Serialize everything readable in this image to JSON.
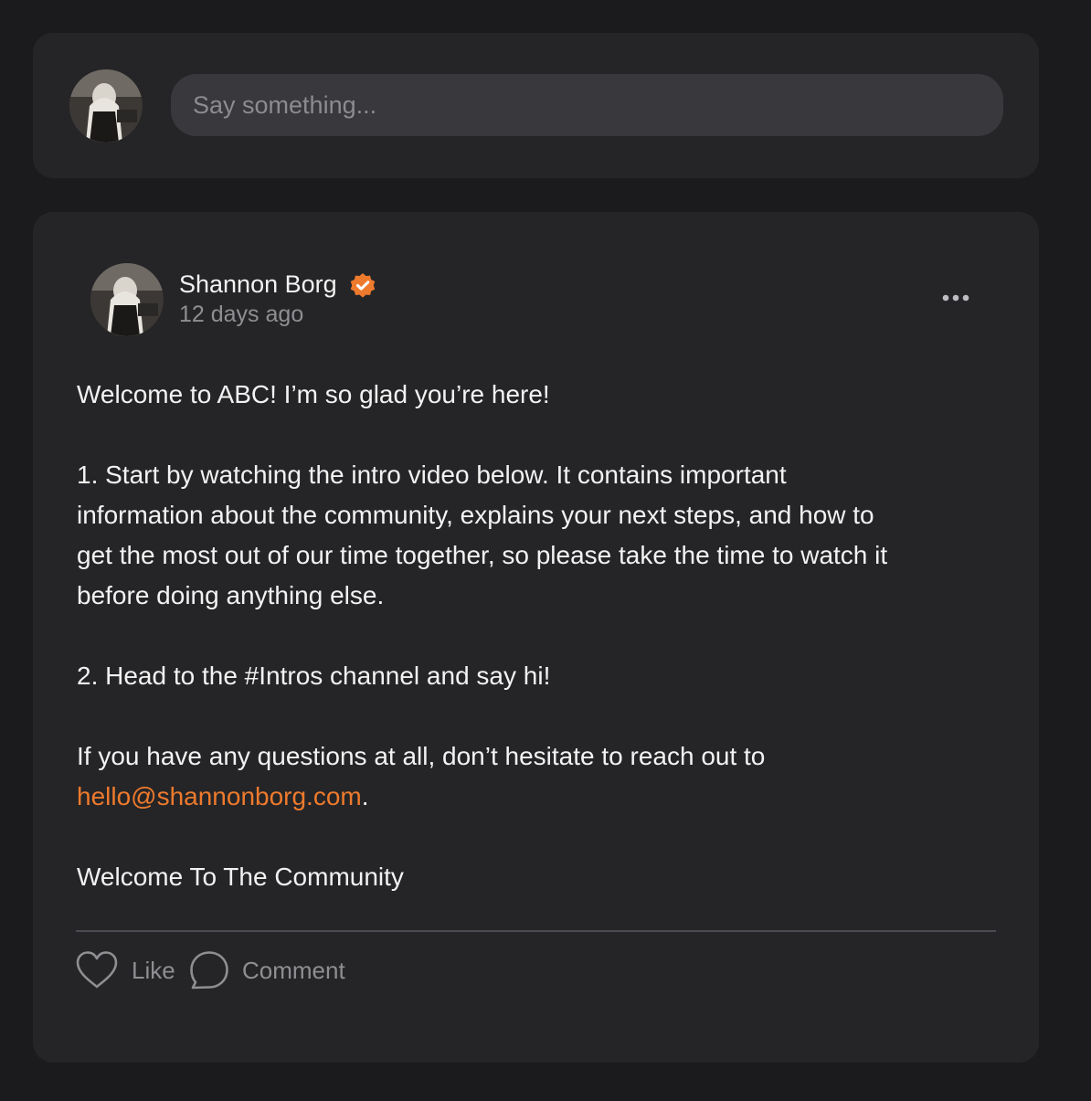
{
  "composer": {
    "placeholder": "Say something..."
  },
  "post": {
    "author": "Shannon Borg",
    "time_ago": "12 days ago",
    "body": {
      "greeting": "Welcome to ABC! I’m so glad you’re here!",
      "step1_line1": "1. Start by watching the intro video below. It contains important",
      "step1_line2": "information about the community, explains your next steps, and how to",
      "step1_line3": "get the most out of our time together, so please take the time to watch it",
      "step1_line4": "before doing anything else.",
      "step2": "2. Head to the #Intros channel and say hi!",
      "questions": "If you have any questions at all, don’t hesitate to reach out to",
      "email": "hello@shannonborg.com",
      "email_suffix": ".",
      "closing": "Welcome To The Community"
    },
    "actions": {
      "like": "Like",
      "comment": "Comment"
    }
  },
  "colors": {
    "accent": "#ee7a2d",
    "background": "#1b1b1d",
    "card": "#252527",
    "input": "#39393d"
  },
  "icons": [
    "user-avatar",
    "verified-badge-icon",
    "more-options-icon",
    "heart-icon",
    "comment-bubble-icon"
  ]
}
